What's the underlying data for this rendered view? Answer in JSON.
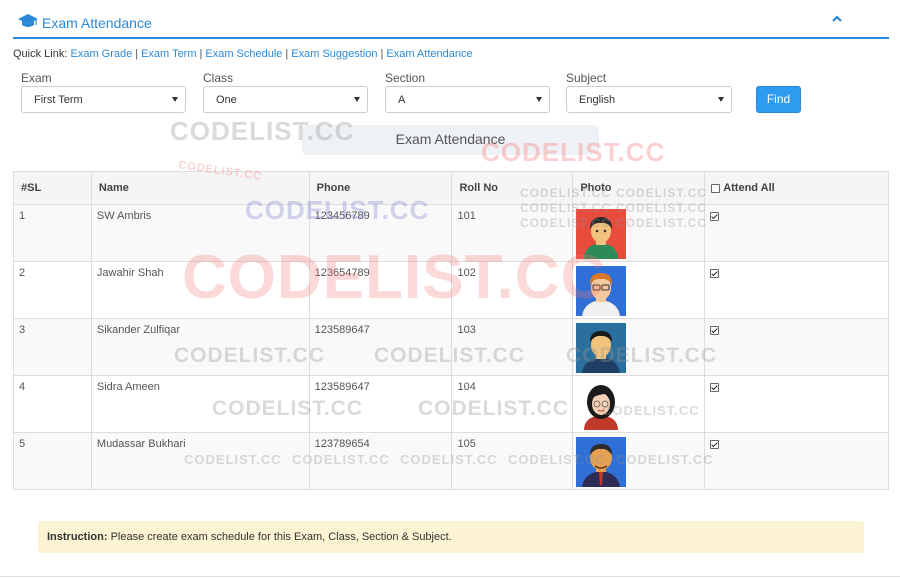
{
  "header": {
    "title": "Exam Attendance",
    "brand_color": "#2b8ad8"
  },
  "quick_links": {
    "prefix": "Quick Link:",
    "links": [
      "Exam Grade",
      "Exam Term",
      "Exam Schedule",
      "Exam Suggestion",
      "Exam Attendance"
    ],
    "separator": "|"
  },
  "filters": {
    "exam": {
      "label": "Exam",
      "value": "First Term"
    },
    "class": {
      "label": "Class",
      "value": "One"
    },
    "section": {
      "label": "Section",
      "value": "A"
    },
    "subject": {
      "label": "Subject",
      "value": "English"
    },
    "find_label": "Find"
  },
  "section_title": "Exam Attendance",
  "table": {
    "columns": [
      "#SL",
      "Name",
      "Phone",
      "Roll No",
      "Photo",
      "Attend All"
    ],
    "rows": [
      {
        "sl": "1",
        "name": "SW Ambris",
        "phone": "123456789",
        "roll": "101",
        "photo": "avatar-boy-red-bg",
        "attend": true
      },
      {
        "sl": "2",
        "name": "Jawahir Shah",
        "phone": "123654789",
        "roll": "102",
        "photo": "avatar-man-glasses",
        "attend": true
      },
      {
        "sl": "3",
        "name": "Sikander Zulfiqar",
        "phone": "123589647",
        "roll": "103",
        "photo": "avatar-man-blue-bg",
        "attend": true
      },
      {
        "sl": "4",
        "name": "Sidra Ameen",
        "phone": "123589647",
        "roll": "104",
        "photo": "avatar-woman-glasses",
        "attend": true
      },
      {
        "sl": "5",
        "name": "Mudassar Bukhari",
        "phone": "123789654",
        "roll": "105",
        "photo": "avatar-man-tie",
        "attend": true
      }
    ],
    "attend_all_checked": false
  },
  "instruction": {
    "label": "Instruction:",
    "text": "Please create exam schedule for this Exam, Class, Section & Subject."
  },
  "watermark": "CODELIST.CC",
  "colors": {
    "accent": "#2b8ad8",
    "button": "#2d9bef",
    "instruction_bg": "#fcf3d2",
    "section_title_bg": "#eef1f5"
  }
}
